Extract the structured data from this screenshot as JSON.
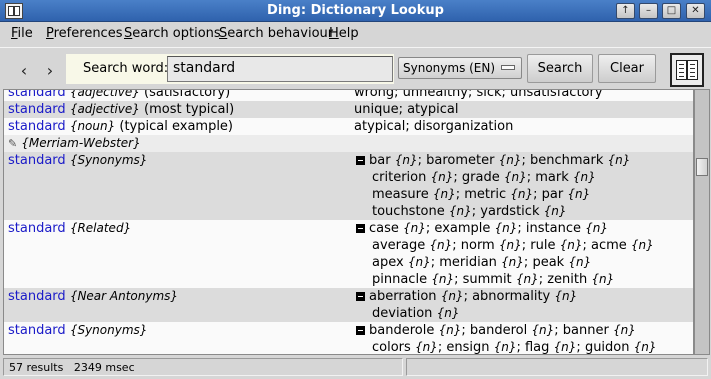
{
  "window": {
    "title": "Ding: Dictionary Lookup",
    "controls": [
      "↑",
      "–",
      "□",
      "✕"
    ]
  },
  "menu": [
    {
      "label": "File",
      "accel": "F",
      "rest": "ile"
    },
    {
      "label": "Preferences",
      "accel": "P",
      "rest": "references"
    },
    {
      "label": "Search options",
      "accel": "S",
      "rest": "earch options"
    },
    {
      "label": "Search behaviour",
      "accel": "S",
      "rest": "earch behaviour"
    },
    {
      "label": "Help",
      "accel": "H",
      "rest": "elp"
    }
  ],
  "toolbar": {
    "back_icon": "‹",
    "forward_icon": "›",
    "search_label": "Search word:",
    "search_value": "standard",
    "language": "Synonyms (EN)",
    "search_button": "Search",
    "clear_button": "Clear",
    "book_icon": "book-icon"
  },
  "results": [
    {
      "style": "white",
      "word": "standard",
      "tag": "{adjective}",
      "note": "(satisfactory)",
      "right": [
        {
          "text": "wrong; unhealthy; sick; unsatisfactory"
        }
      ]
    },
    {
      "style": "alt",
      "word": "standard",
      "tag": "{adjective}",
      "note": "(most typical)",
      "right": [
        {
          "text": "unique; atypical"
        }
      ]
    },
    {
      "style": "white",
      "word": "standard",
      "tag": "{noun}",
      "note": "(typical example)",
      "right": [
        {
          "text": "atypical; disorganization"
        }
      ]
    },
    {
      "style": "src",
      "source": "{Merriam-Webster}"
    },
    {
      "style": "alt",
      "word": "standard",
      "tag": "{Synonyms}",
      "note": "",
      "right": [
        {
          "first": true,
          "parts": [
            [
              "bar",
              "{n}"
            ],
            [
              "barometer",
              "{n}"
            ],
            [
              "benchmark",
              "{n}"
            ]
          ]
        },
        {
          "parts": [
            [
              "criterion",
              "{n}"
            ],
            [
              "grade",
              "{n}"
            ],
            [
              "mark",
              "{n}"
            ]
          ]
        },
        {
          "parts": [
            [
              "measure",
              "{n}"
            ],
            [
              "metric",
              "{n}"
            ],
            [
              "par",
              "{n}"
            ]
          ]
        },
        {
          "parts": [
            [
              "touchstone",
              "{n}"
            ],
            [
              "yardstick",
              "{n}"
            ]
          ]
        }
      ]
    },
    {
      "style": "white",
      "word": "standard",
      "tag": "{Related}",
      "note": "",
      "right": [
        {
          "first": true,
          "parts": [
            [
              "case",
              "{n}"
            ],
            [
              "example",
              "{n}"
            ],
            [
              "instance",
              "{n}"
            ]
          ]
        },
        {
          "parts": [
            [
              "average",
              "{n}"
            ],
            [
              "norm",
              "{n}"
            ],
            [
              "rule",
              "{n}"
            ],
            [
              "acme",
              "{n}"
            ]
          ]
        },
        {
          "parts": [
            [
              "apex",
              "{n}"
            ],
            [
              "meridian",
              "{n}"
            ],
            [
              "peak",
              "{n}"
            ]
          ]
        },
        {
          "parts": [
            [
              "pinnacle",
              "{n}"
            ],
            [
              "summit",
              "{n}"
            ],
            [
              "zenith",
              "{n}"
            ]
          ]
        }
      ]
    },
    {
      "style": "alt",
      "word": "standard",
      "tag": "{Near Antonyms}",
      "note": "",
      "right": [
        {
          "first": true,
          "parts": [
            [
              "aberration",
              "{n}"
            ],
            [
              "abnormality",
              "{n}"
            ]
          ]
        },
        {
          "parts": [
            [
              "deviation",
              "{n}"
            ]
          ]
        }
      ]
    },
    {
      "style": "white",
      "word": "standard",
      "tag": "{Synonyms}",
      "note": "",
      "right": [
        {
          "first": true,
          "parts": [
            [
              "banderole",
              "{n}"
            ],
            [
              "banderol",
              "{n}"
            ],
            [
              "banner",
              "{n}"
            ]
          ]
        },
        {
          "parts": [
            [
              "colors",
              "{n}"
            ],
            [
              "ensign",
              "{n}"
            ],
            [
              "flag",
              "{n}"
            ],
            [
              "guidon",
              "{n}"
            ]
          ]
        }
      ]
    }
  ],
  "status": {
    "results": "57 results",
    "time": "2349 msec"
  }
}
